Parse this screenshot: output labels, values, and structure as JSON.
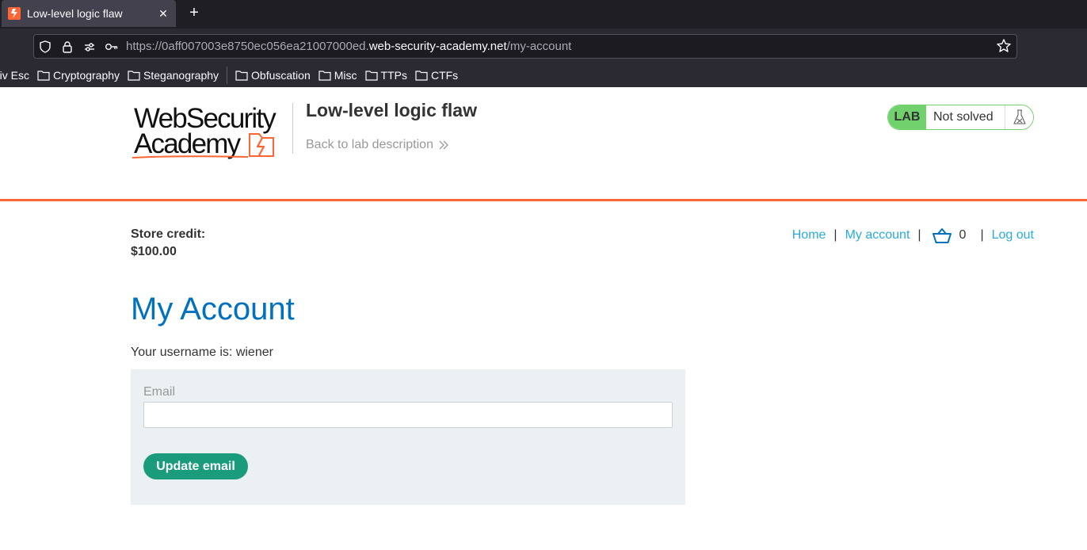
{
  "browser": {
    "tab": {
      "title": "Low-level logic flaw",
      "close": "✕"
    },
    "new_tab": "+",
    "url": {
      "prefix": "https://0aff007003e8750ec056ea21007000ed.",
      "host": "web-security-academy.net",
      "path": "/my-account"
    },
    "bookmarks": [
      {
        "label": "riv Esc",
        "icon": "none"
      },
      {
        "label": "Cryptography",
        "icon": "folder-icon"
      },
      {
        "label": "Steganography",
        "icon": "folder-icon"
      },
      {
        "label": "Obfuscation",
        "icon": "folder-icon"
      },
      {
        "label": "Misc",
        "icon": "folder-icon"
      },
      {
        "label": "TTPs",
        "icon": "folder-icon"
      },
      {
        "label": "CTFs",
        "icon": "folder-icon"
      }
    ]
  },
  "header": {
    "logo_line1": "WebSecurity",
    "logo_line2": "Academy",
    "lab_title": "Low-level logic flaw",
    "back_link": "Back to lab description",
    "lab_badge": "LAB",
    "lab_status": "Not solved"
  },
  "account": {
    "credit_label": "Store credit:",
    "credit_value": "$100.00"
  },
  "nav": {
    "home": "Home",
    "sep1": "|",
    "my_account": "My account",
    "sep2": "|",
    "cart_count": "0",
    "sep3": "|",
    "logout": "Log out"
  },
  "main": {
    "heading": "My Account",
    "username_line": "Your username is: wiener",
    "email_label": "Email",
    "email_value": "",
    "update_button": "Update email"
  },
  "colors": {
    "accent_orange": "#ff6633",
    "link_blue": "#29abe0",
    "heading_blue": "#0071bc",
    "button_green": "#1a9c7c",
    "lab_green": "#70d16d"
  }
}
